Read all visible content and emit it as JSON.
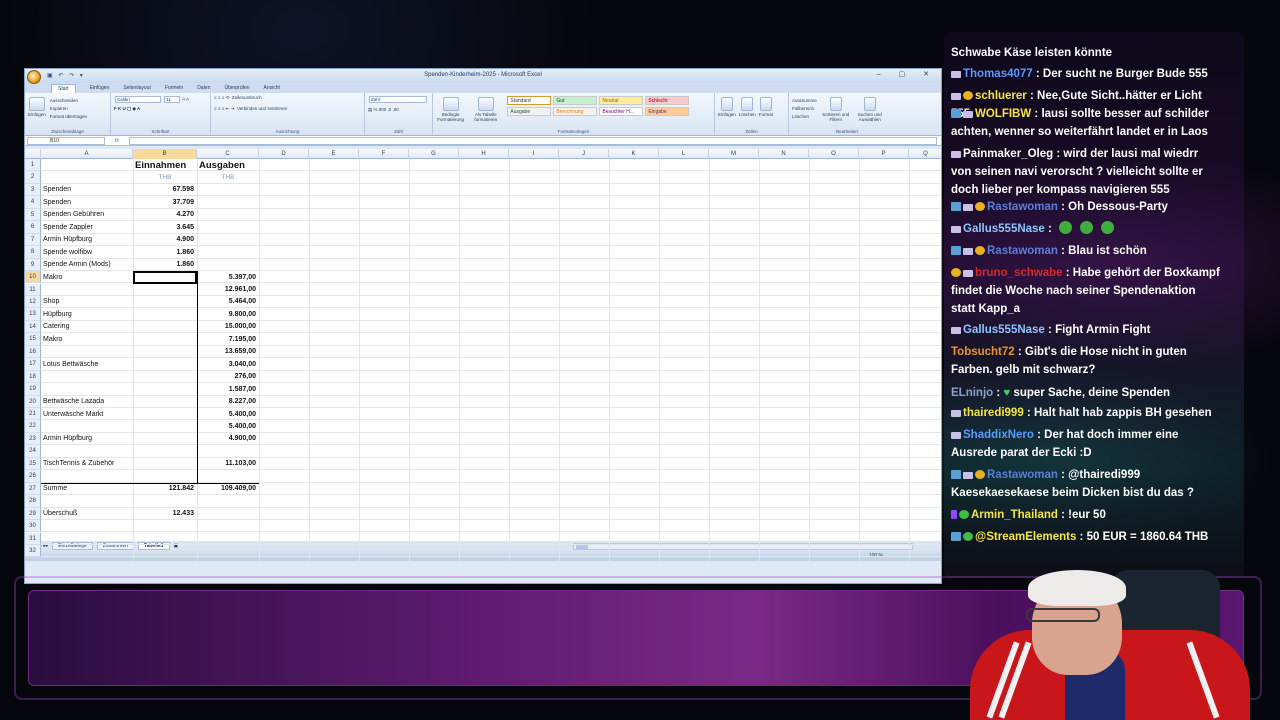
{
  "excel": {
    "window_title": "Spenden-Kinderheim-2025 - Microsoft Excel",
    "tabs": [
      "Start",
      "Einfügen",
      "Seitenlayout",
      "Formeln",
      "Daten",
      "Überprüfen",
      "Ansicht"
    ],
    "ribbon": {
      "paste": "Einfügen",
      "cut": "Ausschneiden",
      "copy": "Kopieren",
      "format_painter": "Format übertragen",
      "clipboard_group": "Zwischenablage",
      "font_name": "Calibri",
      "font_size": "11",
      "font_group": "Schriftart",
      "wrap_text": "Zeilenumbruch",
      "merge_center": "Verbinden und zentrieren",
      "alignment_group": "Ausrichtung",
      "number_format": "Zahl",
      "number_group": "Zahl",
      "conditional_format": "Bedingte Formatierung",
      "as_table": "Als Tabelle formatieren",
      "styles": [
        "Standard",
        "Gut",
        "Neutral",
        "Schlecht",
        "Ausgabe",
        "Berechnung",
        "Besuchter H...",
        "Eingabe"
      ],
      "styles_group": "Formatvorlagen",
      "insert": "Einfügen",
      "delete": "Löschen",
      "format": "Format",
      "cells_group": "Zellen",
      "autosum": "AutoSumme",
      "fill": "Füllbereich",
      "clear": "Löschen",
      "sort_filter": "Sortieren und Filtern",
      "find_select": "Suchen und Auswählen",
      "editing_group": "Bearbeiten"
    },
    "name_box": "B10",
    "fx": "fx",
    "columns": [
      "A",
      "B",
      "C",
      "D",
      "E",
      "F",
      "G",
      "H",
      "I",
      "J",
      "K",
      "L",
      "M",
      "N",
      "O",
      "P",
      "Q"
    ],
    "header_income": "Einnahmen",
    "header_expense": "Ausgaben",
    "unit_b": "THB",
    "unit_c": "THB",
    "rows": [
      {
        "r": "1",
        "a": "",
        "b": "",
        "c": ""
      },
      {
        "r": "2",
        "a": "",
        "b": "",
        "c": ""
      },
      {
        "r": "3",
        "a": "Spenden",
        "b": "67.598",
        "c": ""
      },
      {
        "r": "4",
        "a": "Spenden",
        "b": "37.709",
        "c": ""
      },
      {
        "r": "5",
        "a": "Spenden Gebühren",
        "b": "4.270",
        "c": ""
      },
      {
        "r": "6",
        "a": "Spende Zappler",
        "b": "3.645",
        "c": ""
      },
      {
        "r": "7",
        "a": "Armin Hüpfburg",
        "b": "4.900",
        "c": ""
      },
      {
        "r": "8",
        "a": "Spende wolfibw",
        "b": "1.860",
        "c": ""
      },
      {
        "r": "9",
        "a": "Spende Armin (Mods)",
        "b": "1.860",
        "c": ""
      },
      {
        "r": "10",
        "a": "Makro",
        "b": "",
        "c": "5.397,00"
      },
      {
        "r": "11",
        "a": "",
        "b": "",
        "c": "12.961,00"
      },
      {
        "r": "12",
        "a": "Shop",
        "b": "",
        "c": "5.464,00"
      },
      {
        "r": "13",
        "a": "Hüpfburg",
        "b": "",
        "c": "9.800,00"
      },
      {
        "r": "14",
        "a": "Catering",
        "b": "",
        "c": "15.000,00"
      },
      {
        "r": "15",
        "a": "Makro",
        "b": "",
        "c": "7.195,00"
      },
      {
        "r": "16",
        "a": "",
        "b": "",
        "c": "13.659,00"
      },
      {
        "r": "17",
        "a": "Lotus Bettwäsche",
        "b": "",
        "c": "3.040,00"
      },
      {
        "r": "18",
        "a": "",
        "b": "",
        "c": "276,00"
      },
      {
        "r": "19",
        "a": "",
        "b": "",
        "c": "1.587,00"
      },
      {
        "r": "20",
        "a": "Bettwäsche Lazada",
        "b": "",
        "c": "8.227,00"
      },
      {
        "r": "21",
        "a": "Unterwäsche Markt",
        "b": "",
        "c": "5.400,00"
      },
      {
        "r": "22",
        "a": "",
        "b": "",
        "c": "5.400,00"
      },
      {
        "r": "23",
        "a": "Armin Hüpfburg",
        "b": "",
        "c": "4.900,00"
      },
      {
        "r": "24",
        "a": "",
        "b": "",
        "c": ""
      },
      {
        "r": "25",
        "a": "TischTennis & Zubehör",
        "b": "",
        "c": "11.103,00"
      },
      {
        "r": "26",
        "a": "",
        "b": "",
        "c": ""
      },
      {
        "r": "27",
        "a": "Summe",
        "b": "121.842",
        "c": "109.409,00"
      },
      {
        "r": "28",
        "a": "",
        "b": "",
        "c": ""
      },
      {
        "r": "29",
        "a": "Überschuß",
        "b": "12.433",
        "c": ""
      },
      {
        "r": "30",
        "a": "",
        "b": "",
        "c": ""
      },
      {
        "r": "31",
        "a": "",
        "b": "",
        "c": ""
      },
      {
        "r": "32",
        "a": "",
        "b": "",
        "c": ""
      }
    ],
    "sheet_tabs": [
      "Einzelbelege",
      "Zusammen",
      "Tabelle1"
    ],
    "status": "Bereit",
    "zoom": "100 %"
  },
  "chat": {
    "messages": [
      {
        "user": "",
        "user_color": "#ffffff",
        "badges": [],
        "text": "Schwabe Käse leisten könnte"
      },
      {
        "user": "Thomas4077",
        "user_color": "#5b9bff",
        "badges": [
          "sub"
        ],
        "text": "Der sucht ne Burger Bude 555"
      },
      {
        "user": "schluerer",
        "user_color": "#f5e642",
        "badges": [
          "sub",
          "warn"
        ],
        "text": "Nee,Gute Sicht..hätter er Licht 555"
      },
      {
        "user": "WOLFIBW",
        "user_color": "#f5e642",
        "badges": [
          "mod",
          "sub"
        ],
        "text": "lausi sollte besser auf schilder achten, wenner so weiterfährt landet er in Laos"
      },
      {
        "user": "Painmaker_Oleg",
        "user_color": "#ffffff",
        "badges": [
          "sub"
        ],
        "text": "wird der lausi mal wiedrr von seinen navi verorscht ? vielleicht sollte er doch lieber per kompass navigieren 555"
      },
      {
        "user": "Rastawoman",
        "user_color": "#5b7fd6",
        "badges": [
          "mod",
          "sub",
          "warn"
        ],
        "text": "Oh Dessous-Party"
      },
      {
        "user": "Gallus555Nase",
        "user_color": "#8fc4ff",
        "badges": [
          "sub"
        ],
        "text": ""
      },
      {
        "user": "Rastawoman",
        "user_color": "#5b7fd6",
        "badges": [
          "mod",
          "sub",
          "warn"
        ],
        "text": "Blau ist schön"
      },
      {
        "user": "bruno_schwabe",
        "user_color": "#d42a2a",
        "badges": [
          "warn",
          "sub"
        ],
        "text": "Habe gehört der Boxkampf findet die Woche nach seiner Spendenaktion statt Kapp_a"
      },
      {
        "user": "Gallus555Nase",
        "user_color": "#8fc4ff",
        "badges": [
          "sub"
        ],
        "text": "Fight Armin Fight"
      },
      {
        "user": "Tobsucht72",
        "user_color": "#e8962a",
        "badges": [],
        "text": "Gibt's die Hose nicht in guten Farben. gelb mit schwarz?"
      },
      {
        "user": "ELninjo",
        "user_color": "#8fa0c8",
        "badges": [],
        "text": "super Sache, deine Spenden"
      },
      {
        "user": "thairedi999",
        "user_color": "#f5e642",
        "badges": [
          "sub"
        ],
        "text": "Halt halt hab zappis BH gesehen"
      },
      {
        "user": "ShaddixNero",
        "user_color": "#5b9bff",
        "badges": [
          "sub"
        ],
        "text": "Der hat doch immer eine Ausrede parat der Ecki :D"
      },
      {
        "user": "Rastawoman",
        "user_color": "#5b7fd6",
        "badges": [
          "mod",
          "sub",
          "warn"
        ],
        "text": "@thairedi999 Kaesekaesekaese beim Dicken bist du das ?"
      },
      {
        "user": "Armin_Thailand",
        "user_color": "#f5e642",
        "badges": [
          "prime",
          "ok"
        ],
        "text": "!eur 50"
      },
      {
        "user": "@StreamElements",
        "user_color": "#f5e642",
        "badges": [
          "mod",
          "ok"
        ],
        "text": "50 EUR = 1860.64 THB"
      }
    ]
  }
}
